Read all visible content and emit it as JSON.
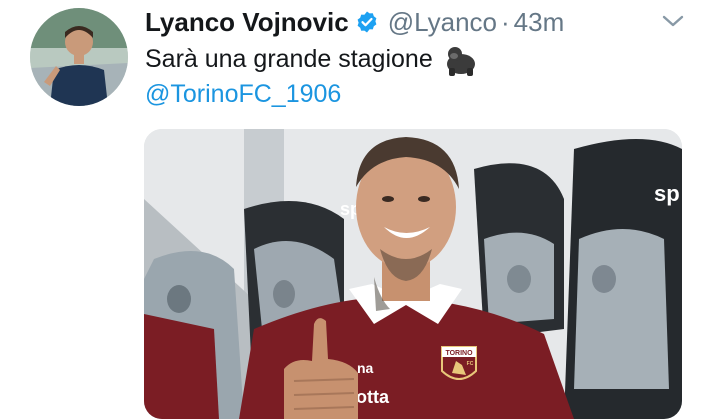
{
  "tweet": {
    "author_name": "Lyanco Vojnovic",
    "handle": "@Lyanco",
    "separator": "·",
    "time": "43m",
    "text": "Sarà una grande stagione",
    "emoji": "gorilla",
    "mention": "@TorinoFC_1906"
  },
  "media": {
    "jersey_sponsor_partial": "na",
    "jersey_sponsor_partial_2": "otta",
    "badge_text": "TORINO",
    "badge_sub": "FC",
    "seat_brand_partial": "sp"
  },
  "icons": {
    "verified": "verified-badge-icon",
    "menu": "chevron-down-icon",
    "emoji": "gorilla-emoji-icon"
  },
  "colors": {
    "text_primary": "#14171a",
    "text_secondary": "#657786",
    "link": "#1b95e0",
    "verified": "#1da1f2",
    "torino_maroon": "#7b1d24"
  }
}
